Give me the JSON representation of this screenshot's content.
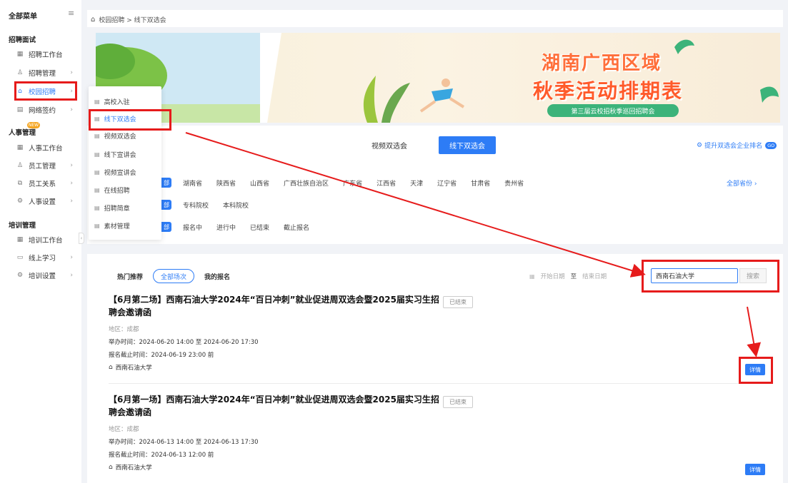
{
  "sidebar": {
    "header": "全部菜单",
    "toggle_icon": "≡",
    "groups": [
      {
        "label": "招聘面试"
      },
      {
        "label": "人事管理"
      },
      {
        "label": "培训管理"
      }
    ],
    "items": [
      {
        "label": "招聘工作台",
        "icon": "grid-icon",
        "chevron": ""
      },
      {
        "label": "招聘管理",
        "icon": "person-icon",
        "chevron": "›"
      },
      {
        "label": "校园招聘",
        "icon": "school-icon",
        "chevron": "›"
      },
      {
        "label": "网络签约",
        "icon": "doc-icon",
        "chevron": "›"
      },
      {
        "label": "人事工作台",
        "icon": "grid-icon",
        "chevron": ""
      },
      {
        "label": "员工管理",
        "icon": "person-icon",
        "chevron": "›"
      },
      {
        "label": "员工关系",
        "icon": "link-icon",
        "chevron": "›"
      },
      {
        "label": "人事设置",
        "icon": "settings-icon",
        "chevron": "›"
      },
      {
        "label": "培训工作台",
        "icon": "grid-icon",
        "chevron": ""
      },
      {
        "label": "线上学习",
        "icon": "monitor-icon",
        "chevron": "›"
      },
      {
        "label": "培训设置",
        "icon": "settings-icon",
        "chevron": "›"
      }
    ],
    "new_badge": "NEW"
  },
  "submenu": {
    "items": [
      {
        "label": "高校入驻"
      },
      {
        "label": "线下双选会"
      },
      {
        "label": "视频双选会"
      },
      {
        "label": "线下宣讲会"
      },
      {
        "label": "视频宣讲会"
      },
      {
        "label": "在线招聘"
      },
      {
        "label": "招聘简章"
      },
      {
        "label": "素材管理"
      }
    ]
  },
  "breadcrumb": {
    "text": "校园招聘 > 线下双选会"
  },
  "banner": {
    "title_line1": "湖南广西区域",
    "title_line2": "秋季活动排期表",
    "subtitle": "第三届云校招秋季巡回招聘会"
  },
  "tabs": {
    "video": "视频双选会",
    "offline": "线下双选会"
  },
  "rank_link": {
    "label": "提升双选会企业排名",
    "go": "GO"
  },
  "filters": {
    "all_label": "部",
    "provinces": [
      "湖南省",
      "陕西省",
      "山西省",
      "广西壮族自治区",
      "广东省",
      "江西省",
      "天津",
      "辽宁省",
      "甘肃省",
      "贵州省"
    ],
    "all_provinces": "全部省份 ›",
    "school_types": [
      "专科院校",
      "本科院校"
    ],
    "statuses": [
      "报名中",
      "进行中",
      "已结束",
      "截止报名"
    ]
  },
  "list": {
    "tabs": [
      "热门推荐",
      "全部场次",
      "我的报名"
    ],
    "start_placeholder": "开始日期",
    "to": "至",
    "end_placeholder": "结束日期",
    "search_value": "西南石油大学",
    "search_button": "搜索",
    "events": [
      {
        "title": "【6月第二场】西南石油大学2024年“百日冲刺”就业促进周双选会暨2025届实习生招聘会邀请函",
        "status": "已结束",
        "region": "地区：成都",
        "time": "举办时间：2024-06-20 14:00  至  2024-06-20 17:30",
        "deadline": "报名截止时间：2024-06-19 23:00 前",
        "school": "西南石油大学",
        "detail": "详情"
      },
      {
        "title": "【6月第一场】西南石油大学2024年“百日冲刺”就业促进周双选会暨2025届实习生招聘会邀请函",
        "status": "已结束",
        "region": "地区：成都",
        "time": "举办时间：2024-06-13 14:00  至  2024-06-13 17:30",
        "deadline": "报名截止时间：2024-06-13 12:00 前",
        "school": "西南石油大学",
        "detail": "详情"
      }
    ]
  },
  "colors": {
    "accent": "#2d7cf6",
    "annotation_red": "#e61b1b"
  }
}
